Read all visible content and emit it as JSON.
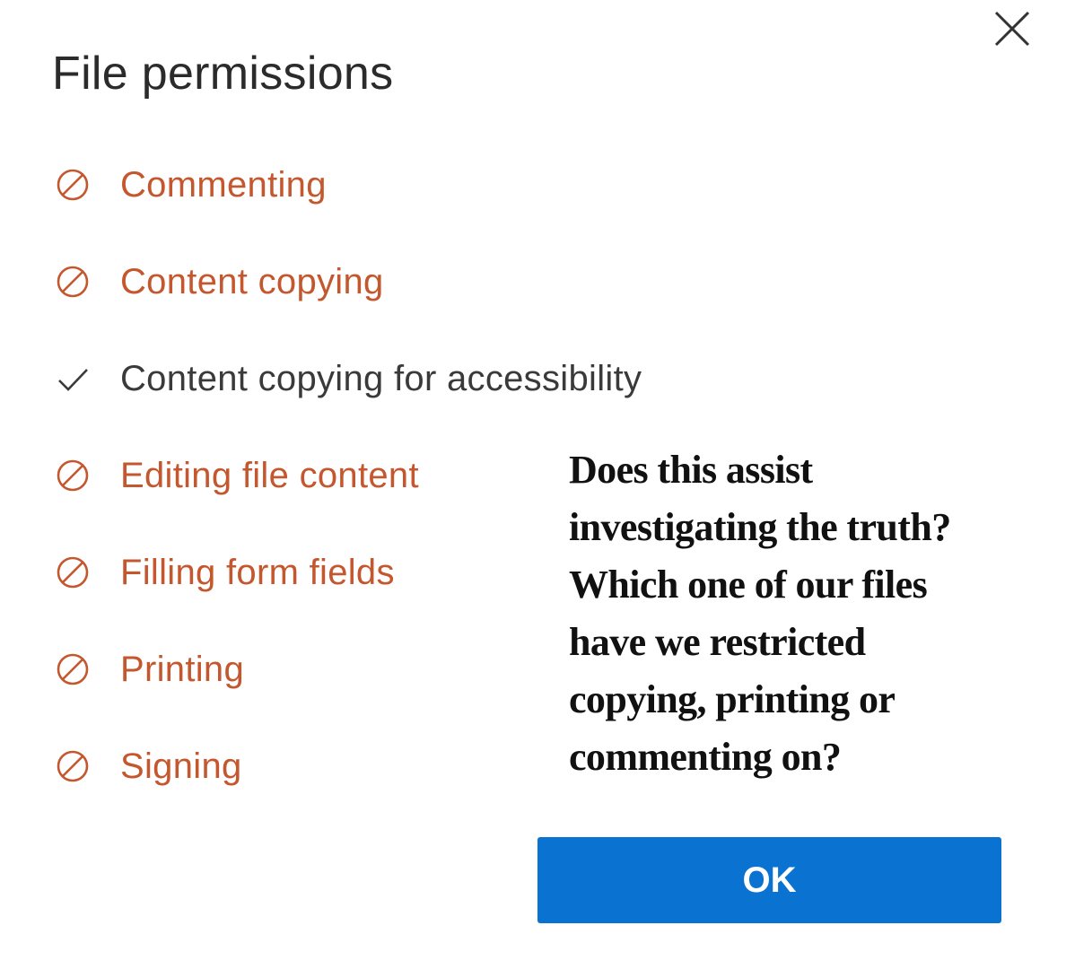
{
  "dialog": {
    "title": "File permissions",
    "close_icon": "close-icon",
    "ok_label": "OK"
  },
  "permissions": [
    {
      "label": "Commenting",
      "status": "denied",
      "icon": "blocked-icon"
    },
    {
      "label": "Content copying",
      "status": "denied",
      "icon": "blocked-icon"
    },
    {
      "label": "Content copying for accessibility",
      "status": "allowed",
      "icon": "checkmark-icon"
    },
    {
      "label": "Editing file content",
      "status": "denied",
      "icon": "blocked-icon"
    },
    {
      "label": "Filling form fields",
      "status": "denied",
      "icon": "blocked-icon"
    },
    {
      "label": "Printing",
      "status": "denied",
      "icon": "blocked-icon"
    },
    {
      "label": "Signing",
      "status": "denied",
      "icon": "blocked-icon"
    }
  ],
  "note": {
    "lines": [
      "Does this assist",
      "investigating the truth?",
      "Which one of our files",
      "have we restricted",
      "copying, printing or",
      "commenting on?"
    ]
  },
  "colors": {
    "denied": "#c4572e",
    "allowed": "#3a3a3a",
    "ok_button": "#0a72d1",
    "title": "#2b2b2b"
  }
}
